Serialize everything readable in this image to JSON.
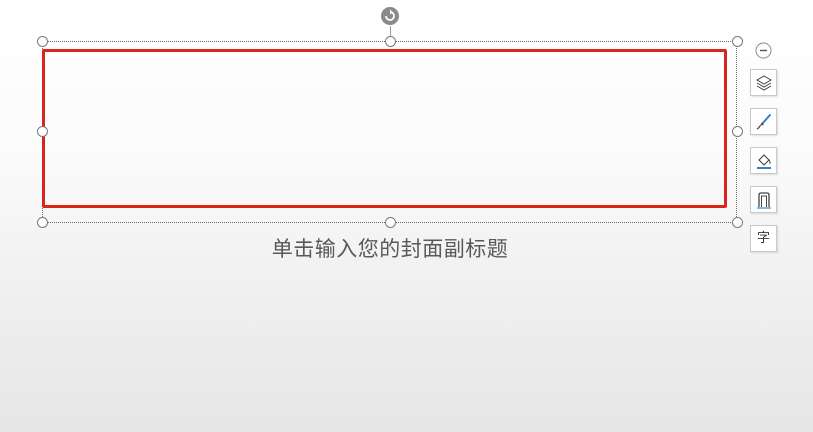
{
  "slide": {
    "subtitle_placeholder": "单击输入您的封面副标题"
  },
  "shape": {
    "outline_color": "#d9261c"
  },
  "toolbar": {
    "collapse_icon": "minus-circle-icon",
    "buttons": [
      {
        "name": "layer-icon"
      },
      {
        "name": "brush-icon"
      },
      {
        "name": "fill-bucket-icon"
      },
      {
        "name": "outline-icon"
      },
      {
        "name": "text-icon",
        "glyph": "字"
      }
    ]
  },
  "colors": {
    "accent_blue": "#3a7fc4",
    "handle_border": "#7a7a7a"
  }
}
